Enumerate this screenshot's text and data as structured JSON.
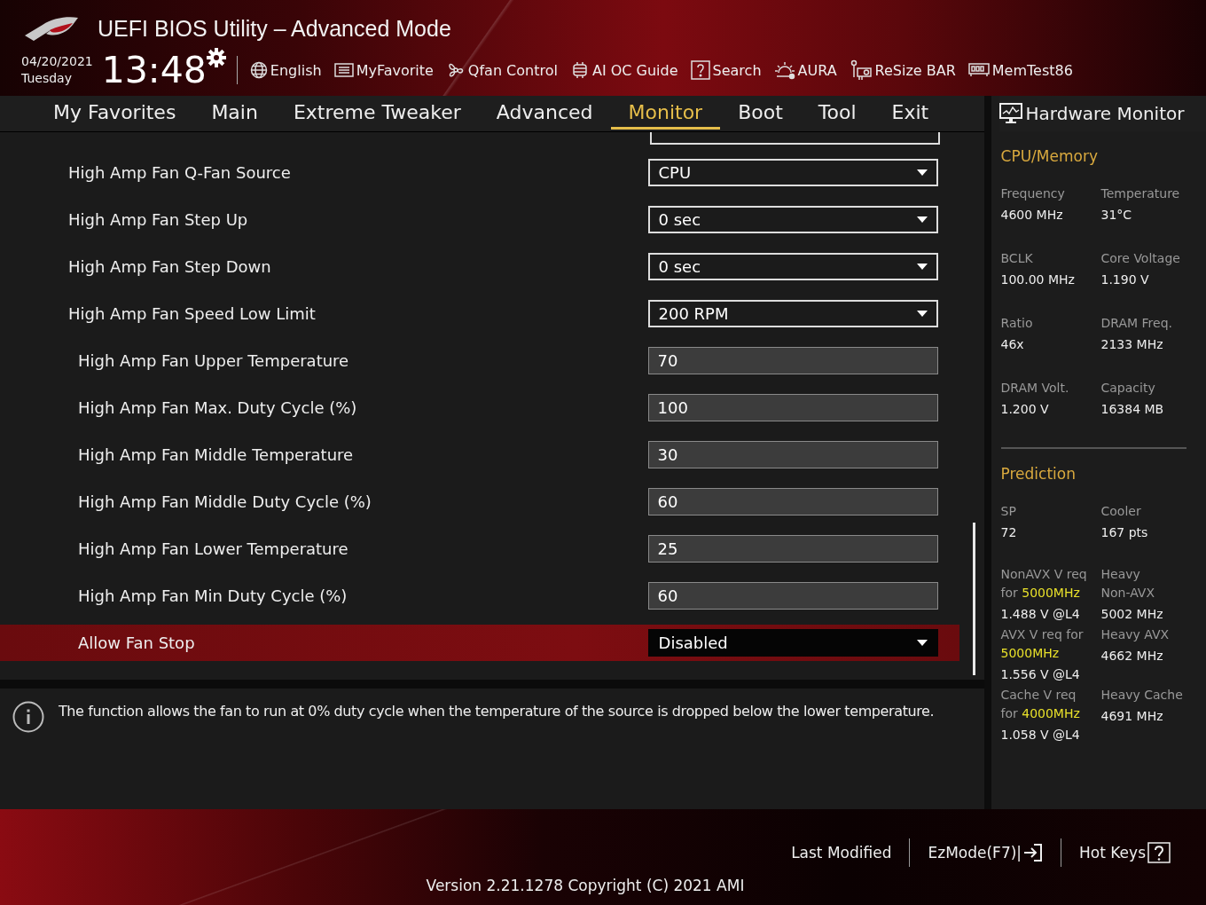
{
  "window": {
    "title": "UEFI BIOS Utility – Advanced Mode"
  },
  "clock": {
    "date": "04/20/2021",
    "day": "Tuesday",
    "time": "13:48"
  },
  "tools": [
    {
      "label": "English"
    },
    {
      "label": "MyFavorite"
    },
    {
      "label": "Qfan Control"
    },
    {
      "label": "AI OC Guide"
    },
    {
      "label": "Search"
    },
    {
      "label": "AURA"
    },
    {
      "label": "ReSize BAR"
    },
    {
      "label": "MemTest86"
    }
  ],
  "tabs": [
    {
      "label": "My Favorites",
      "selected": false
    },
    {
      "label": "Main",
      "selected": false
    },
    {
      "label": "Extreme Tweaker",
      "selected": false
    },
    {
      "label": "Advanced",
      "selected": false
    },
    {
      "label": "Monitor",
      "selected": true
    },
    {
      "label": "Boot",
      "selected": false
    },
    {
      "label": "Tool",
      "selected": false
    },
    {
      "label": "Exit",
      "selected": false
    }
  ],
  "settings": [
    {
      "label": "High Amp Fan Q-Fan Source",
      "kind": "select",
      "value": "CPU",
      "selected": false
    },
    {
      "label": "High Amp Fan Step Up",
      "kind": "select",
      "value": "0 sec",
      "selected": false
    },
    {
      "label": "High Amp Fan Step Down",
      "kind": "select",
      "value": "0 sec",
      "selected": false
    },
    {
      "label": "High Amp Fan Speed Low Limit",
      "kind": "select",
      "value": "200 RPM",
      "selected": false,
      "children": [
        {
          "label": "High Amp Fan Upper Temperature",
          "kind": "number",
          "value": "70",
          "selected": false
        },
        {
          "label": "High Amp Fan Max. Duty Cycle (%)",
          "kind": "number",
          "value": "100",
          "selected": false
        },
        {
          "label": "High Amp Fan Middle Temperature",
          "kind": "number",
          "value": "30",
          "selected": false
        },
        {
          "label": "High Amp Fan Middle Duty Cycle (%)",
          "kind": "number",
          "value": "60",
          "selected": false
        },
        {
          "label": "High Amp Fan Lower Temperature",
          "kind": "number",
          "value": "25",
          "selected": false
        },
        {
          "label": "High Amp Fan Min Duty Cycle (%)",
          "kind": "number",
          "value": "60",
          "selected": false
        },
        {
          "label": "Allow Fan Stop",
          "kind": "select",
          "value": "Disabled",
          "selected": true
        }
      ]
    }
  ],
  "help": {
    "text": "The function allows the fan to run at 0% duty cycle when the temperature of the source is dropped below the lower temperature."
  },
  "hardware_monitor": {
    "title": "Hardware Monitor",
    "sections": [
      {
        "title": "CPU/Memory",
        "items": [
          {
            "label": "Frequency",
            "value": "4600 MHz"
          },
          {
            "label": "Temperature",
            "value": "31°C"
          },
          {
            "label": "BCLK",
            "value": "100.00 MHz"
          },
          {
            "label": "Core Voltage",
            "value": "1.190 V"
          },
          {
            "label": "Ratio",
            "value": "46x"
          },
          {
            "label": "DRAM Freq.",
            "value": "2133 MHz"
          },
          {
            "label": "DRAM Volt.",
            "value": "1.200 V"
          },
          {
            "label": "Capacity",
            "value": "16384 MB"
          }
        ]
      },
      {
        "title": "Prediction",
        "items": [
          {
            "label": "SP",
            "value": "72"
          },
          {
            "label": "Cooler",
            "value": "167 pts"
          },
          {
            "label": "NonAVX V req for **5000MHz**",
            "value": "1.488 V @L4"
          },
          {
            "label": "Heavy Non-AVX",
            "value": "5002 MHz"
          },
          {
            "label": "AVX V req for **5000MHz**",
            "value": "1.556 V @L4"
          },
          {
            "label": "Heavy AVX",
            "value": "4662 MHz"
          },
          {
            "label": "Cache V req for **4000MHz**",
            "value": "1.058 V @L4"
          },
          {
            "label": "Heavy Cache",
            "value": "4691 MHz"
          }
        ]
      }
    ]
  },
  "footer": {
    "actions": [
      {
        "label": "Last Modified"
      },
      {
        "label": "EzMode(F7)|"
      },
      {
        "label": "Hot Keys"
      }
    ],
    "version": "Version 2.21.1278 Copyright (C) 2021 AMI"
  }
}
